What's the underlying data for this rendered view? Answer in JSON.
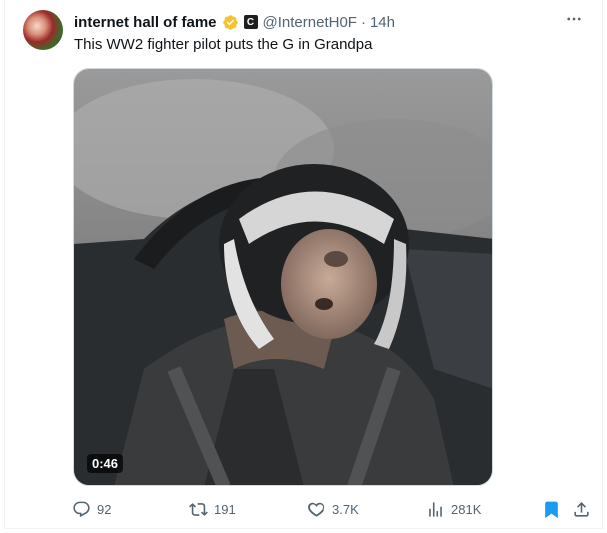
{
  "tweet": {
    "author_name": "internet hall of fame",
    "handle": "@InternetH0F",
    "separator": "·",
    "time": "14h",
    "brand_badge": "C",
    "text": "This WW2 fighter pilot puts the G in Grandpa",
    "more_icon": "more-horizontal-icon"
  },
  "media": {
    "duration": "0:46"
  },
  "actions": {
    "replies": "92",
    "reposts": "191",
    "likes": "3.7K",
    "views": "281K"
  },
  "colors": {
    "verified": "#f4c430",
    "bookmark_active": "#1d9bf0",
    "muted": "#536471"
  }
}
